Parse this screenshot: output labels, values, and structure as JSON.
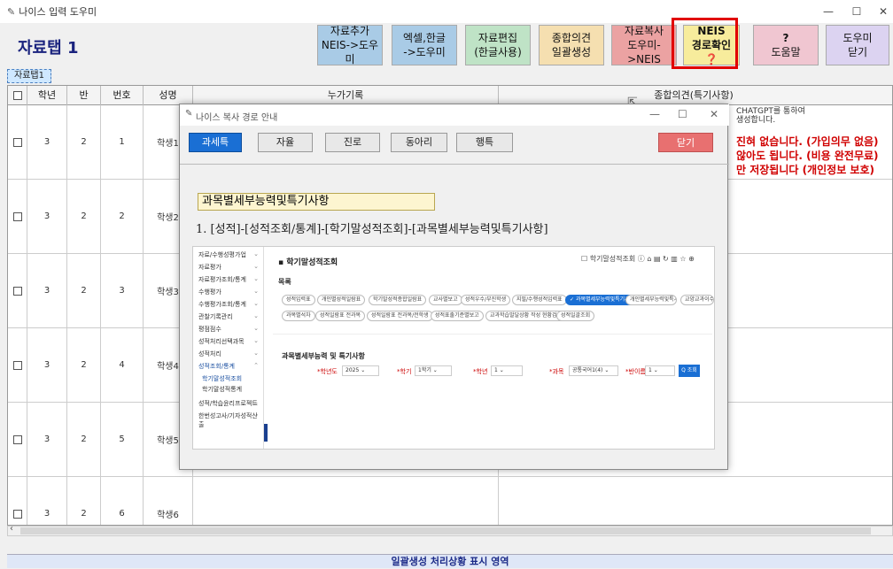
{
  "window": {
    "title": "나이스 입력 도우미",
    "minimize": "—",
    "maximize": "☐",
    "close": "✕"
  },
  "tab_title": "자료탭 1",
  "toolbar": [
    {
      "line1": "자료추가",
      "line2": "NEIS->도우미",
      "bg": "#a9cbe6"
    },
    {
      "line1": "엑셀,한글",
      "line2": "->도우미",
      "bg": "#a9cbe6"
    },
    {
      "line1": "자료편집",
      "line2": "(한글사용)",
      "bg": "#bfe3c6"
    },
    {
      "line1": "종합의견",
      "line2": "일괄생성",
      "bg": "#f5dfb0"
    },
    {
      "line1": "자료복사",
      "line2": "도우미->NEIS",
      "bg": "#eba2a2"
    },
    {
      "line1": "NEIS",
      "line2": "경로확인",
      "bg": "#f7ec9c"
    },
    {
      "line1": "?",
      "line2": "도움말",
      "bg": "#f0c6d1"
    },
    {
      "line1": "도우미",
      "line2": "닫기",
      "bg": "#dcd3f1"
    }
  ],
  "data_tab": "자료탭1",
  "grid": {
    "headers": [
      "",
      "학년",
      "반",
      "번호",
      "성명",
      "누가기록",
      "종합의견(특기사항)"
    ],
    "rows": [
      {
        "grade": "3",
        "class": "2",
        "num": "1",
        "name": "학생1"
      },
      {
        "grade": "3",
        "class": "2",
        "num": "2",
        "name": "학생2"
      },
      {
        "grade": "3",
        "class": "2",
        "num": "3",
        "name": "학생3"
      },
      {
        "grade": "3",
        "class": "2",
        "num": "4",
        "name": "학생4"
      },
      {
        "grade": "3",
        "class": "2",
        "num": "5",
        "name": "학생5"
      },
      {
        "grade": "3",
        "class": "2",
        "num": "6",
        "name": "학생6"
      }
    ],
    "summary_note": [
      "CHATGPT를 통하여",
      "생성합니다."
    ],
    "red_lines": [
      "진혀 없습니다. (가입의무 없음)",
      "않아도 됩니다. (비용 완전무료)",
      "만 저장됩니다 (개인정보 보호)"
    ]
  },
  "status": "일괄생성 처리상황 표시 영역",
  "modal": {
    "title": "나이스 복사 경로 안내",
    "tabs": [
      "과세특",
      "자율",
      "진로",
      "동아리",
      "행특"
    ],
    "close": "닫기",
    "heading": "과목별세부능력및특기사항",
    "path": "1. [성적]-[성적조회/통계]-[학기말성적조회]-[과목별세부능력및특기사항]",
    "shot": {
      "title": "학기말성적조회",
      "subtitle": "과목별세부능력 및 특기사항",
      "section": "목록",
      "menu": [
        "자료/수행성평가업",
        "자료평가",
        "자료평가조회/통계",
        "수행평가",
        "수행평가조회/통계",
        "관찰기록관리",
        "평점점수",
        "성적처리선택과목",
        "성적처리",
        "성적조회/통계",
        "학기말성적조회",
        "학기말성적통계",
        "성적/학습윤리프로젝트",
        "한번성고사/기자성적산출"
      ],
      "pills": [
        "성적입력표",
        "개인별성적일람표",
        "학기말성적종합일람표",
        "교사별보고",
        "성적우수/부진학생",
        "지필/수행성적입력표",
        "과목별세부능력및특기사항",
        "개인별세부능력및특기사항",
        "교양교과이수여부",
        "과목별석차",
        "성적일람표 전과목",
        "성적일람표 전과목/전학생",
        "성적표출기준별보고",
        "교과학습발달상황 작성 현황검색",
        "성적일괄조회"
      ],
      "filters": [
        {
          "label": "*학년도",
          "value": "2025"
        },
        {
          "label": "*학기",
          "value": "1학기"
        },
        {
          "label": "*학년",
          "value": "1"
        },
        {
          "label": "*과목",
          "value": "공통국어1(4)"
        },
        {
          "label": "*반이름",
          "value": "1"
        }
      ],
      "search": "Q 조회",
      "tools": "☐ 학기말성적조회   ⓘ  ⌂  ▤  ↻  ▥  ☆  ⊕"
    }
  }
}
